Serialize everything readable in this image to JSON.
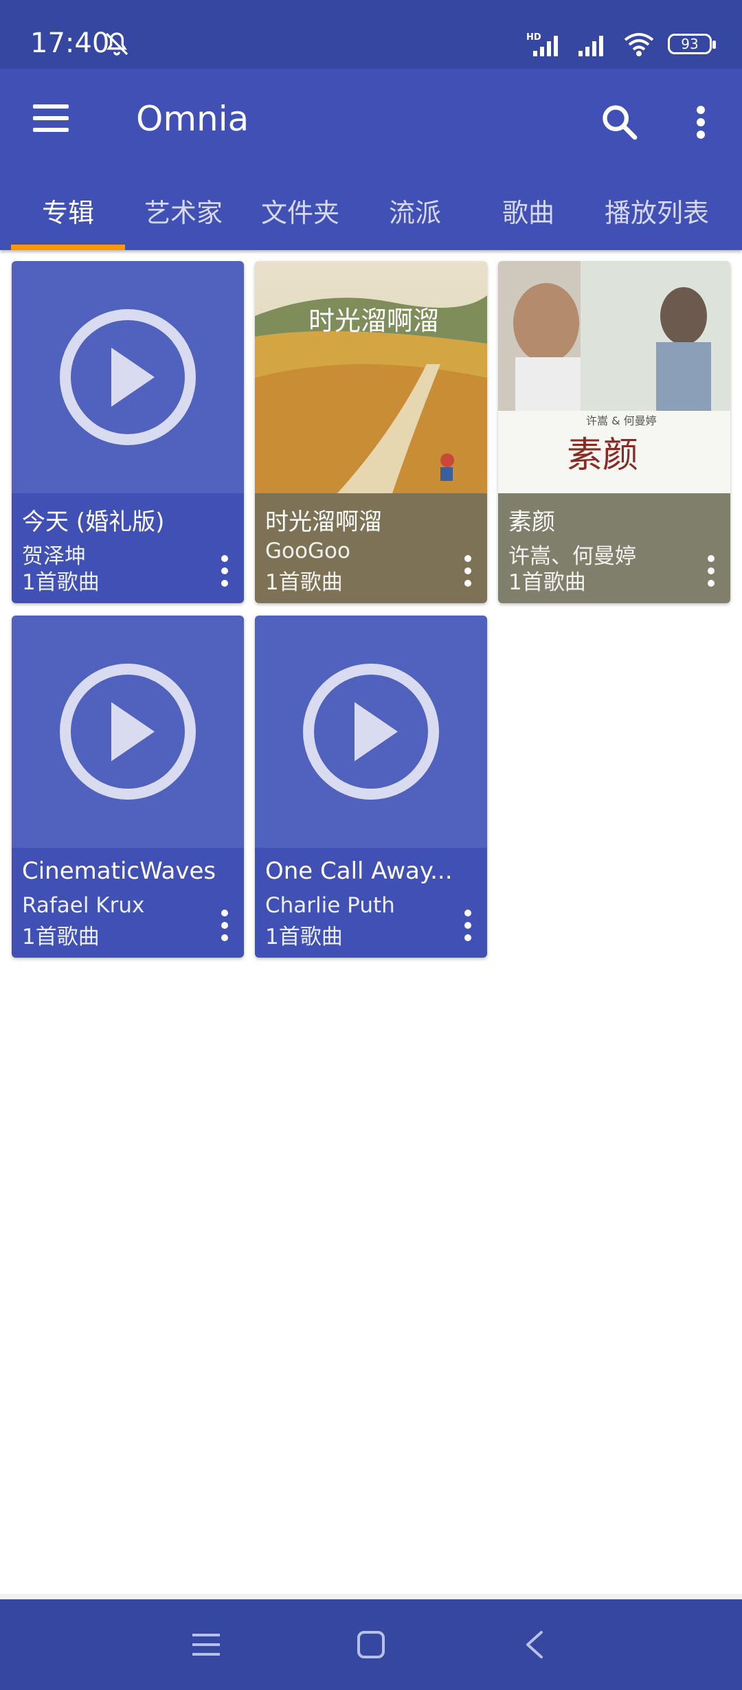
{
  "status_bar": {
    "time": "17:40",
    "battery": "93",
    "network": "HD"
  },
  "app_bar": {
    "title": "Omnia"
  },
  "tabs": [
    {
      "label": "专辑",
      "active": true
    },
    {
      "label": "艺术家",
      "active": false
    },
    {
      "label": "文件夹",
      "active": false
    },
    {
      "label": "流派",
      "active": false
    },
    {
      "label": "歌曲",
      "active": false
    },
    {
      "label": "播放列表",
      "active": false
    }
  ],
  "albums": [
    {
      "title": "今天 (婚礼版)",
      "artist": "贺泽坤",
      "count": "1首歌曲",
      "art": "placeholder",
      "info_color": "#4050B5"
    },
    {
      "title": "时光溜啊溜",
      "artist": "GooGoo",
      "count": "1首歌曲",
      "art": "cover",
      "art_text": "时光溜啊溜",
      "info_color": "#7D7256"
    },
    {
      "title": "素颜",
      "artist": "许嵩、何曼婷",
      "count": "1首歌曲",
      "art": "cover",
      "art_text": "素颜",
      "art_subtext": "许嵩 & 何曼婷",
      "info_color": "#7F7F6C"
    },
    {
      "title": "CinematicWaves",
      "artist": "Rafael Krux",
      "count": "1首歌曲",
      "art": "placeholder",
      "info_color": "#4050B5"
    },
    {
      "title": "One Call Away...",
      "artist": "Charlie Puth",
      "count": "1首歌曲",
      "art": "placeholder",
      "info_color": "#4050B5"
    }
  ],
  "colors": {
    "primary": "#4050B5",
    "primary_dark": "#3547A0",
    "accent": "#FF9800",
    "placeholder_art": "#5061BE"
  }
}
